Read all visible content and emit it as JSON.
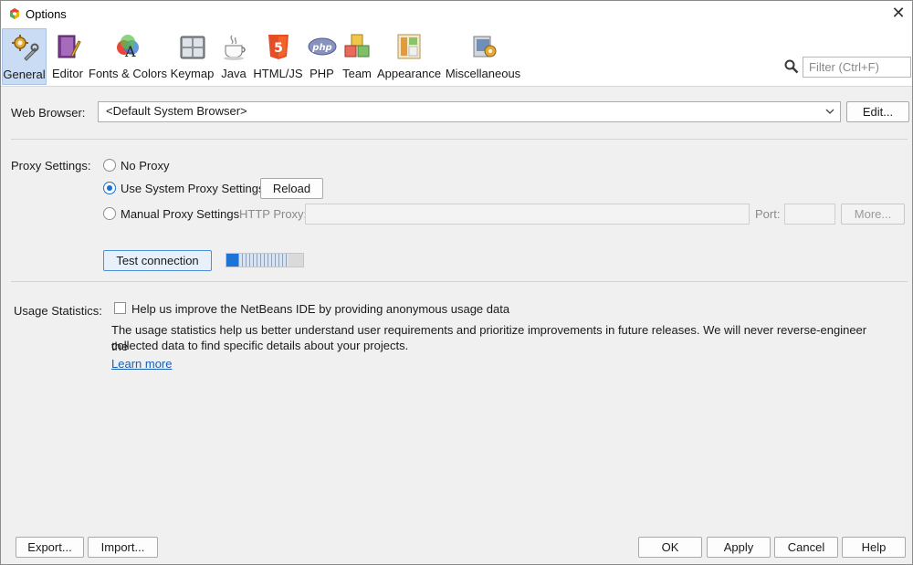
{
  "window": {
    "title": "Options",
    "close_glyph": "✕"
  },
  "toolbar": {
    "items": [
      {
        "label": "General",
        "icon": "general-icon",
        "selected": true
      },
      {
        "label": "Editor",
        "icon": "editor-icon"
      },
      {
        "label": "Fonts & Colors",
        "icon": "fonts-colors-icon"
      },
      {
        "label": "Keymap",
        "icon": "keymap-icon"
      },
      {
        "label": "Java",
        "icon": "java-icon"
      },
      {
        "label": "HTML/JS",
        "icon": "html5-icon"
      },
      {
        "label": "PHP",
        "icon": "php-icon"
      },
      {
        "label": "Team",
        "icon": "team-icon"
      },
      {
        "label": "Appearance",
        "icon": "appearance-icon"
      },
      {
        "label": "Miscellaneous",
        "icon": "miscellaneous-icon"
      }
    ],
    "filter_placeholder": "Filter (Ctrl+F)"
  },
  "web_browser": {
    "label": "Web Browser:",
    "value": "<Default System Browser>",
    "edit_button": "Edit..."
  },
  "proxy": {
    "label": "Proxy Settings:",
    "options": [
      "No Proxy",
      "Use System Proxy Settings",
      "Manual Proxy Settings"
    ],
    "selected": "Use System Proxy Settings",
    "reload_button": "Reload",
    "http_proxy_label": "HTTP Proxy:",
    "port_label": "Port:",
    "more_button": "More...",
    "test_button": "Test connection",
    "test_progress": 0.16
  },
  "usage": {
    "label": "Usage Statistics:",
    "checkbox_label": "Help us improve the NetBeans IDE by providing anonymous usage data",
    "checked": false,
    "description_line1": "The usage statistics help us better understand user requirements and prioritize improvements in future releases. We will never reverse-engineer the",
    "description_line2": "collected data to find specific details about your projects.",
    "learn_more": "Learn more"
  },
  "footer": {
    "export": "Export...",
    "import": "Import...",
    "ok": "OK",
    "apply": "Apply",
    "cancel": "Cancel",
    "help": "Help"
  },
  "colors": {
    "accent": "#1a6fd1",
    "selected_tab": "#c9dcf3",
    "link": "#1a5fb4"
  }
}
